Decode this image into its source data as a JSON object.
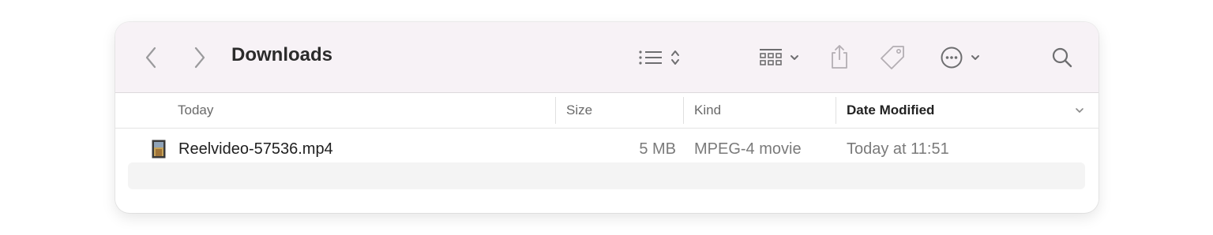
{
  "window": {
    "title": "Downloads"
  },
  "toolbar": {
    "back_icon": "chevron-left-icon",
    "forward_icon": "chevron-right-icon",
    "view_icon": "list-view-icon",
    "group_icon": "group-grid-icon",
    "share_icon": "share-icon",
    "tag_icon": "tag-icon",
    "more_icon": "ellipsis-circle-icon",
    "search_icon": "search-icon"
  },
  "columns": {
    "name": "Today",
    "size": "Size",
    "kind": "Kind",
    "date": "Date Modified"
  },
  "files": [
    {
      "name": "Reelvideo-57536.mp4",
      "size": "5 MB",
      "kind": "MPEG-4 movie",
      "date": "Today at 11:51",
      "icon": "video-file-icon"
    }
  ],
  "colors": {
    "toolbar_bg": "#f7f2f6",
    "alt_row_bg": "#f4f4f4",
    "icon_gray": "#6e6e70"
  }
}
